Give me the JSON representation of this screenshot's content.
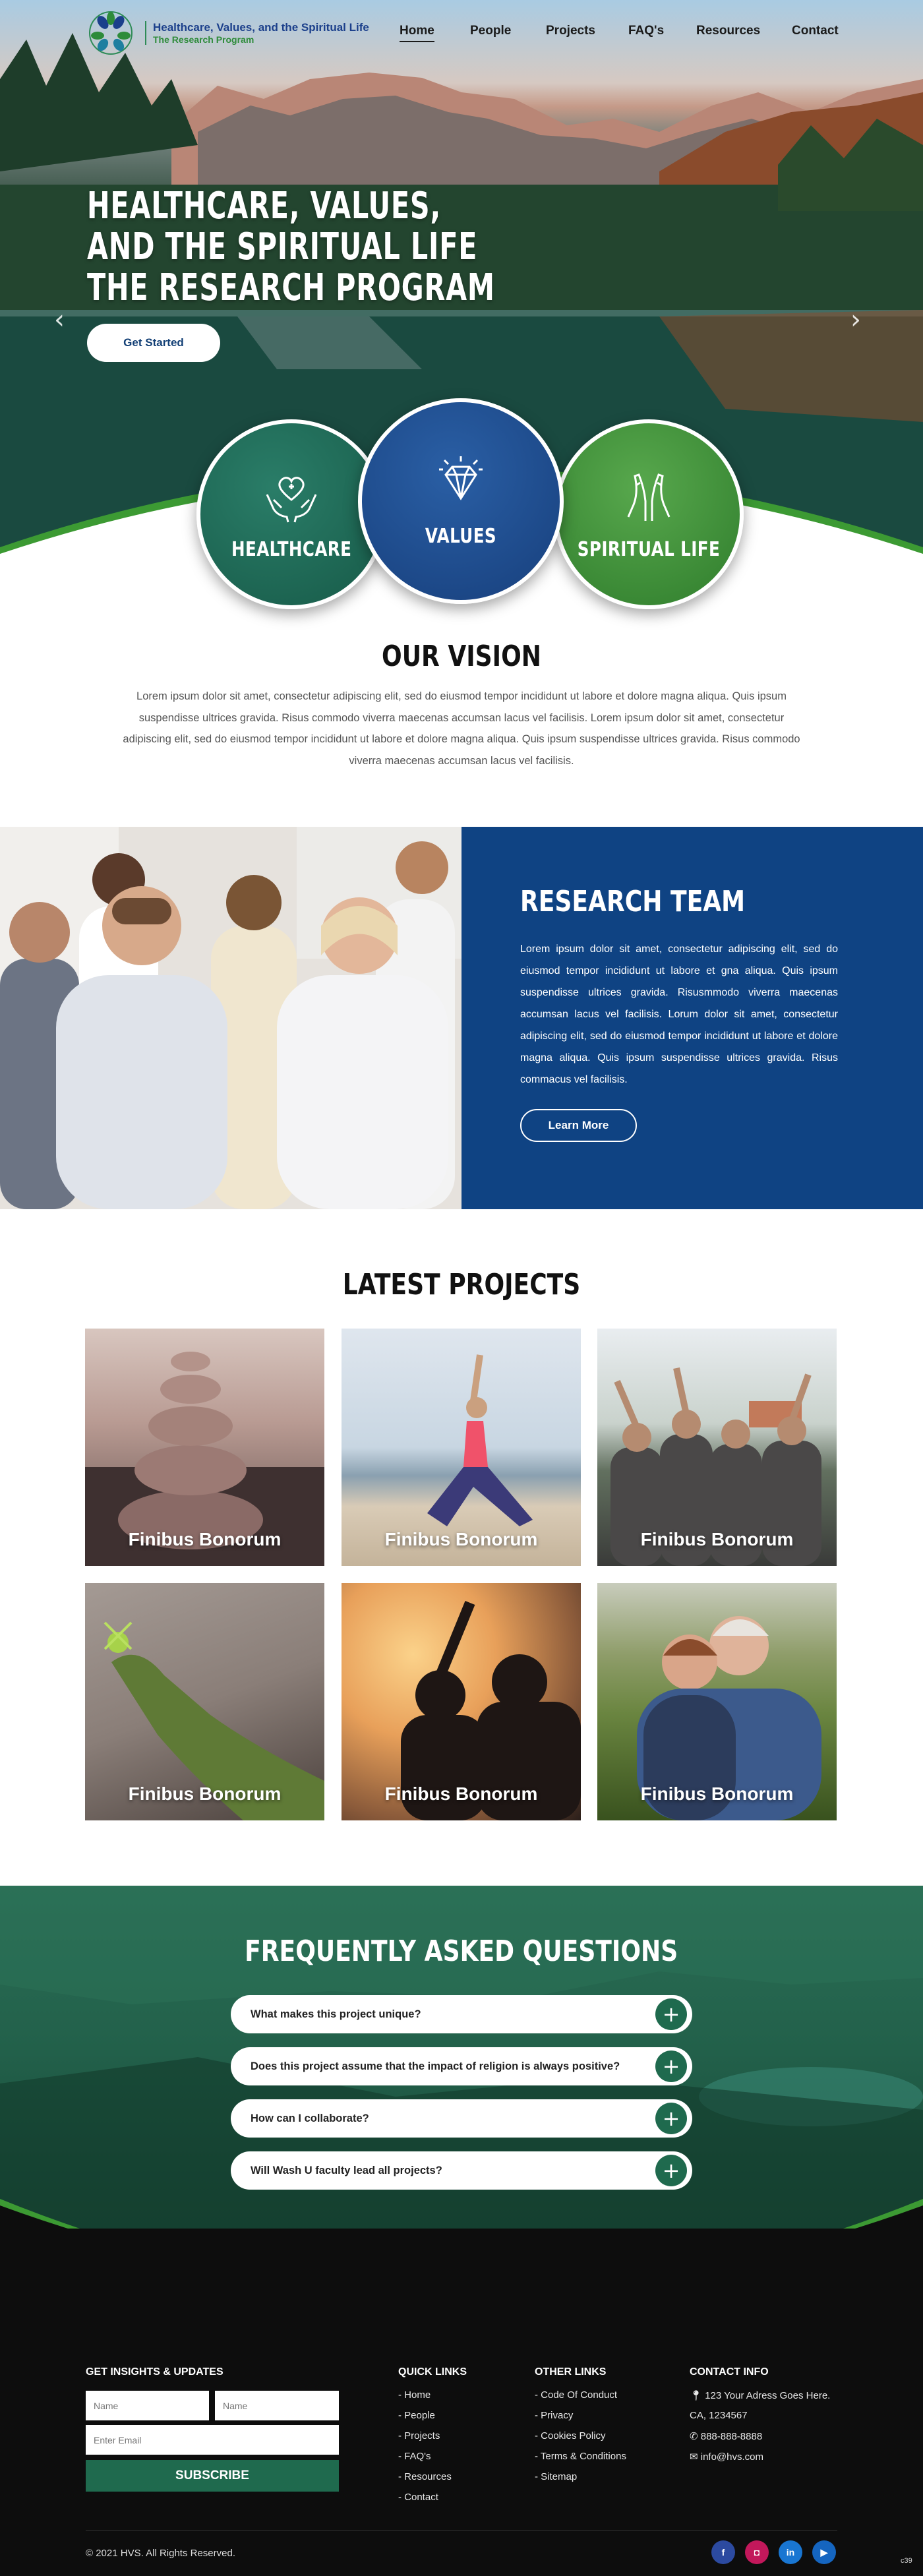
{
  "logo": {
    "title": "Healthcare, Values, and the Spiritual Life",
    "subtitle": "The Research Program"
  },
  "nav": {
    "items": [
      "Home",
      "People",
      "Projects",
      "FAQ's",
      "Resources",
      "Contact"
    ],
    "active": "Home"
  },
  "hero": {
    "title_lines": [
      "HEALTHCARE, VALUES,",
      "AND THE SPIRITUAL LIFE",
      "THE RESEARCH PROGRAM"
    ],
    "cta": "Get Started",
    "prev_icon": "chevron-left-icon",
    "next_icon": "chevron-right-icon"
  },
  "pillars": [
    {
      "label": "HEALTHCARE",
      "icon": "hands-heart-cross-icon",
      "color": "#1c6b57"
    },
    {
      "label": "VALUES",
      "icon": "diamond-icon",
      "color": "#1b4a8a"
    },
    {
      "label": "SPIRITUAL LIFE",
      "icon": "praying-hands-icon",
      "color": "#3f8b3a"
    }
  ],
  "vision": {
    "title": "OUR VISION",
    "text": "Lorem ipsum dolor sit amet, consectetur adipiscing elit, sed do eiusmod tempor incididunt ut labore et dolore magna aliqua. Quis ipsum suspendisse ultrices gravida. Risus commodo viverra maecenas accumsan lacus vel facilisis. Lorem ipsum dolor sit amet, consectetur adipiscing elit, sed do eiusmod tempor incididunt ut labore et dolore magna aliqua. Quis ipsum suspendisse ultrices gravida. Risus commodo viverra maecenas accumsan lacus vel facilisis."
  },
  "team": {
    "title": "RESEARCH TEAM",
    "text": "Lorem ipsum dolor sit amet, consectetur adipiscing elit, sed do eiusmod tempor incididunt ut labore et gna aliqua. Quis ipsum suspendisse ultrices gravida. Risusmmodo viverra maecenas accumsan lacus vel facilisis. Lorum dolor sit amet, consectetur adipiscing elit, sed do eiusmod tempor incididunt ut labore et dolore magna aliqua. Quis ipsum suspendisse ultrices gravida. Risus commacus vel facilisis.",
    "button": "Learn More"
  },
  "projects": {
    "title": "LATEST PROJECTS",
    "cards": [
      {
        "caption": "Finibus Bonorum",
        "scene": "stacked-stones"
      },
      {
        "caption": "Finibus Bonorum",
        "scene": "yoga-beach"
      },
      {
        "caption": "Finibus Bonorum",
        "scene": "group-meditation"
      },
      {
        "caption": "Finibus Bonorum",
        "scene": "moss-hand"
      },
      {
        "caption": "Finibus Bonorum",
        "scene": "sunset-silhouette"
      },
      {
        "caption": "Finibus Bonorum",
        "scene": "elderly-couple-hug"
      }
    ]
  },
  "faq": {
    "title": "FREQUENTLY ASKED QUESTIONS",
    "questions": [
      "What makes this project unique?",
      "Does this project assume that the impact of religion is always positive?",
      "How can I collaborate?",
      "Will Wash U faculty lead all projects?"
    ]
  },
  "footer": {
    "insights_title": "GET INSIGHTS & UPDATES",
    "name_placeholder_1": "Name",
    "name_placeholder_2": "Name",
    "email_placeholder": "Enter Email",
    "subscribe": "SUBSCRIBE",
    "quick_title": "QUICK LINKS",
    "quick_links": [
      "- Home",
      "- People",
      "- Projects",
      "- FAQ's",
      "- Resources",
      "- Contact"
    ],
    "other_title": "OTHER LINKS",
    "other_links": [
      "- Code Of Conduct",
      "- Privacy",
      "- Cookies Policy",
      "- Terms & Conditions",
      "- Sitemap"
    ],
    "contact_title": "CONTACT INFO",
    "address_1": "123 Your Adress Goes Here.",
    "address_2": "CA, 1234567",
    "phone": "888-888-8888",
    "email": "info@hvs.com",
    "copyright": "© 2021  HVS. All Rights Reserved.",
    "social": [
      {
        "icon": "facebook-icon",
        "glyph": "f",
        "color": "#2c4aa0"
      },
      {
        "icon": "instagram-icon",
        "glyph": "◘",
        "color": "#c2185b"
      },
      {
        "icon": "linkedin-icon",
        "glyph": "in",
        "color": "#1976d2"
      },
      {
        "icon": "youtube-icon",
        "glyph": "▶",
        "color": "#1565c0"
      }
    ],
    "corner": "c39"
  }
}
